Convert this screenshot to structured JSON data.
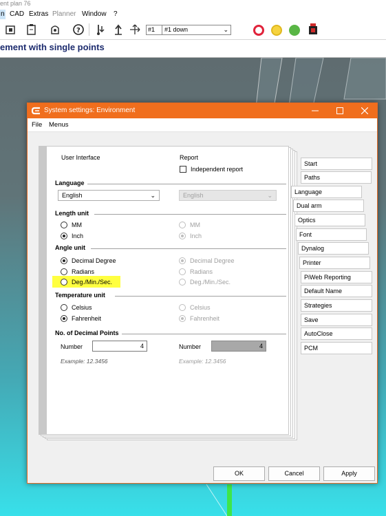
{
  "app": {
    "title_partial": "ent plan 76",
    "menu": [
      {
        "label": "n",
        "state": "current"
      },
      {
        "label": "CAD",
        "state": "normal"
      },
      {
        "label": "Extras",
        "state": "normal"
      },
      {
        "label": "Planner",
        "state": "disabled"
      },
      {
        "label": "Window",
        "state": "normal"
      },
      {
        "label": "?",
        "state": "normal"
      }
    ],
    "toolbar": {
      "number_value": "#1",
      "select_value": "#1 down",
      "lamps": [
        "#e0223a",
        "#f6d33f",
        "#59b645"
      ]
    },
    "subtitle_partial": "ement with single points"
  },
  "dialog": {
    "title": "System settings: Environment",
    "menu": [
      "File",
      "Menus"
    ],
    "headers": {
      "ui": "User Interface",
      "report": "Report"
    },
    "independent_report_label": "Independent report",
    "sections": {
      "language": "Language",
      "length": "Length unit",
      "angle": "Angle unit",
      "temperature": "Temperature unit",
      "decimals": "No. of Decimal Points"
    },
    "language": {
      "ui_value": "English",
      "report_value": "English"
    },
    "length_options": [
      "MM",
      "Inch"
    ],
    "angle_options": [
      "Decimal Degree",
      "Radians",
      "Deg./Min./Sec."
    ],
    "temperature_options": [
      "Celsius",
      "Fahrenheit"
    ],
    "decimals": {
      "number_label": "Number",
      "ui_value": "4",
      "report_value": "4",
      "example_ui": "Example: 12.3456",
      "example_report": "Example: 12.3456"
    },
    "side_tabs": [
      "Start",
      "Paths",
      "Language",
      "Dual arm",
      "Optics",
      "Font",
      "Dynalog",
      "Printer",
      "PiWeb Reporting",
      "Default Name",
      "Strategies",
      "Save",
      "AutoClose",
      "PCM"
    ],
    "buttons": {
      "ok": "OK",
      "cancel": "Cancel",
      "apply": "Apply"
    },
    "highlight_color": "#ffff40",
    "accent": "#f06e1d"
  }
}
